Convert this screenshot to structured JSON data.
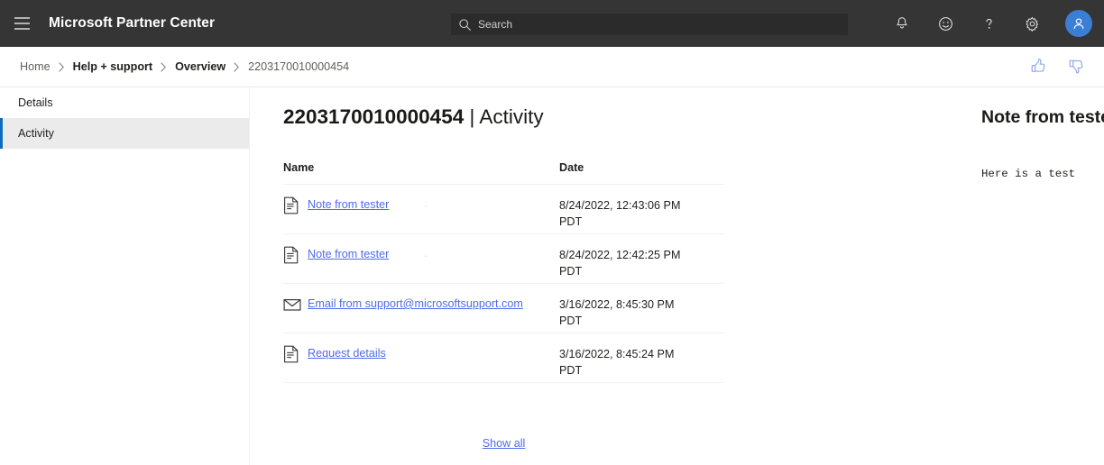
{
  "topbar": {
    "menu_icon": "hamburger-icon",
    "brand": "Microsoft Partner Center",
    "search": {
      "placeholder": "Search",
      "value": "",
      "icon": "search-icon"
    },
    "actions": [
      {
        "name": "notifications",
        "icon": "bell-icon"
      },
      {
        "name": "feedback",
        "icon": "smiley-icon"
      },
      {
        "name": "help",
        "icon": "question-mark-icon"
      },
      {
        "name": "settings",
        "icon": "gear-icon"
      },
      {
        "name": "account",
        "icon": "person-avatar-icon"
      }
    ]
  },
  "breadcrumb": {
    "items": [
      {
        "label": "Home",
        "style": "muted"
      },
      {
        "label": "Help + support",
        "style": "strong"
      },
      {
        "label": "Overview",
        "style": "strong"
      },
      {
        "label": "2203170010000454",
        "style": "last"
      }
    ],
    "separator": "›",
    "feedback": [
      {
        "name": "thumbs-up",
        "icon": "thumbs-up-icon"
      },
      {
        "name": "thumbs-down",
        "icon": "thumbs-down-icon"
      }
    ]
  },
  "sidebar": {
    "items": [
      {
        "label": "Details",
        "selected": false
      },
      {
        "label": "Activity",
        "selected": true
      }
    ]
  },
  "main": {
    "title_id": "2203170010000454",
    "title_separator": " | ",
    "title_section": "Activity",
    "table": {
      "headers": {
        "name": "Name",
        "date": "Date"
      },
      "rows": [
        {
          "icon": "document-icon",
          "name": "Note from tester",
          "trailing_mark": ".",
          "date": "8/24/2022, 12:43:06 PM",
          "timezone": "PDT"
        },
        {
          "icon": "document-icon",
          "name": "Note from tester",
          "trailing_mark": ".",
          "date": "8/24/2022, 12:42:25 PM",
          "timezone": "PDT"
        },
        {
          "icon": "envelope-icon",
          "name": "Email from support@microsoftsupport.com",
          "trailing_mark": "",
          "date": "3/16/2022, 8:45:30 PM",
          "timezone": "PDT"
        },
        {
          "icon": "document-icon",
          "name": "Request details",
          "trailing_mark": "",
          "date": "3/16/2022, 8:45:24 PM",
          "timezone": "PDT"
        }
      ]
    },
    "show_all_label": "Show all"
  },
  "detail_panel": {
    "title": "Note from tester",
    "body": "Here is a test",
    "close_icon": "close-icon"
  },
  "colors": {
    "topbar_bg": "#353535",
    "search_bg": "#2b2b2b",
    "avatar_bg": "#3a7fd5",
    "link": "#4f6bed",
    "accent_bar": "#0f6cbd",
    "selected_bg": "#ebebeb",
    "thumbs": "#93a8e8"
  }
}
